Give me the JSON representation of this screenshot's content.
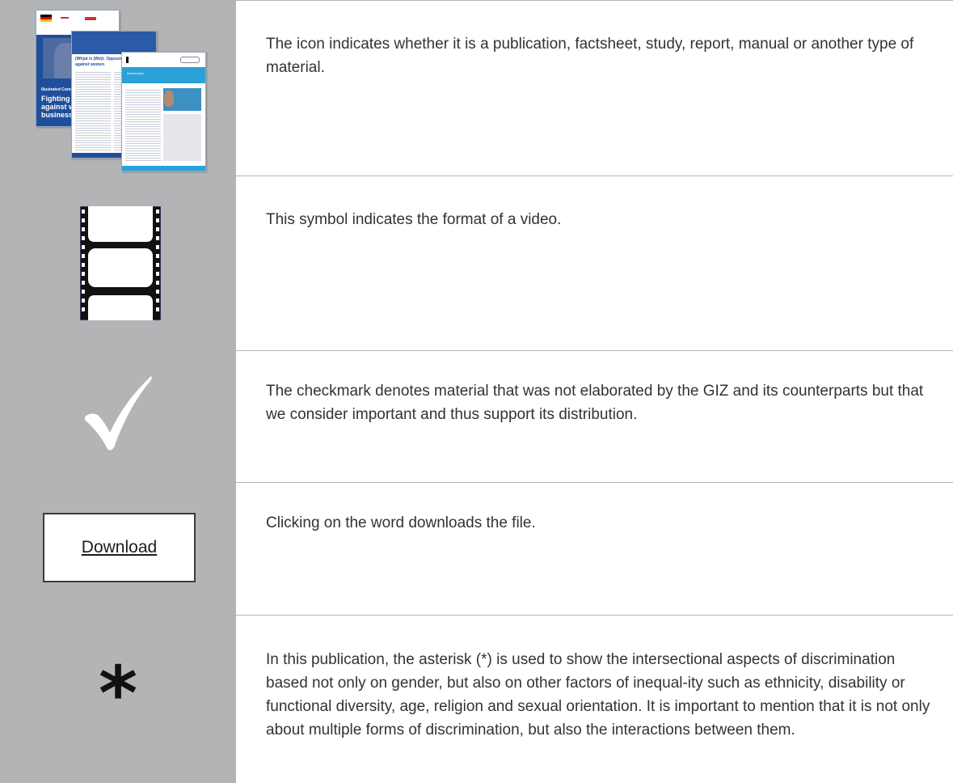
{
  "rows": [
    {
      "icon": "publication-stack-icon",
      "description": "The icon indicates whether it is a publication, factsheet, study, report, manual or another type of material."
    },
    {
      "icon": "film-strip-icon",
      "description": "This symbol indicates the format of a video."
    },
    {
      "icon": "checkmark-icon",
      "description": "The checkmark denotes material that was not elaborated by the GIZ and its counterparts but that we consider important and thus support its distribution."
    },
    {
      "icon": "download-button",
      "download_label": "Download",
      "description": "Clicking on the word downloads the file."
    },
    {
      "icon": "asterisk-icon",
      "symbol": "*",
      "description": "In this publication, the asterisk (*) is used to show the intersectional aspects of discrimination based not only on gender, but also on other factors of inequal-ity such as ethnicity, disability or functional diversity, age, religion and sexual orientation. It is important to mention that it is not only about multiple forms of discrimination, but also the interactions between them."
    }
  ],
  "thumbnails": {
    "cover_lines": [
      "Illustrated Concepts",
      "Fighting vi",
      "against wo",
      "business i"
    ],
    "middle_title": "(Wh)at is (Wo)t: Opposing all for",
    "middle_subtitle": "against women",
    "front_title": "Introduction"
  },
  "colors": {
    "icon_column": "#b3b4b6",
    "divider": "#b3b4b6",
    "text": "#333333",
    "brand_blue": "#1f4e9a",
    "light_blue": "#2aa1d8"
  }
}
